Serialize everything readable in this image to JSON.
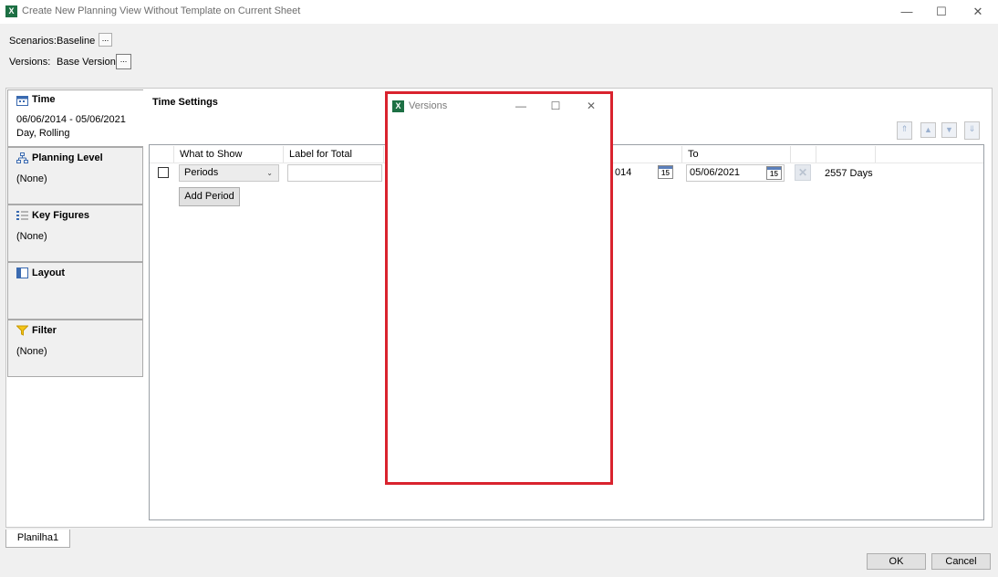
{
  "window": {
    "title": "Create New Planning View Without Template on Current Sheet",
    "minimize": "—",
    "maximize": "☐",
    "close": "✕",
    "icon_label": "X"
  },
  "header": {
    "scenarios_label": "Scenarios:",
    "scenarios_value": "Baseline",
    "versions_label": "Versions:",
    "versions_value": "Base Version",
    "ellipsis": "..."
  },
  "nav": {
    "items": [
      {
        "title": "Time",
        "value": "06/06/2014 - 05/06/2021\nDay, Rolling",
        "icon": "calendar-icon"
      },
      {
        "title": "Planning Level",
        "value": "(None)",
        "icon": "hierarchy-icon"
      },
      {
        "title": "Key Figures",
        "value": "(None)",
        "icon": "list-icon"
      },
      {
        "title": "Layout",
        "value": "",
        "icon": "layout-icon"
      },
      {
        "title": "Filter",
        "value": "(None)",
        "icon": "filter-icon"
      }
    ]
  },
  "time_settings": {
    "title": "Time Settings",
    "columns": {
      "what_to_show": "What to Show",
      "label_for_total": "Label for Total",
      "to": "To"
    },
    "row": {
      "what_to_show": "Periods",
      "label_for_total": "",
      "from_partial": "014",
      "to": "05/06/2021",
      "days": "2557 Days",
      "cal_day": "15"
    },
    "add_period": "Add Period"
  },
  "sheet_tab": "Planilha1",
  "footer": {
    "ok": "OK",
    "cancel": "Cancel"
  },
  "popup": {
    "title": "Versions",
    "minimize": "—",
    "maximize": "☐",
    "close": "✕"
  },
  "colors": {
    "popup_border": "#d9232e",
    "excel_green": "#1d7044"
  }
}
